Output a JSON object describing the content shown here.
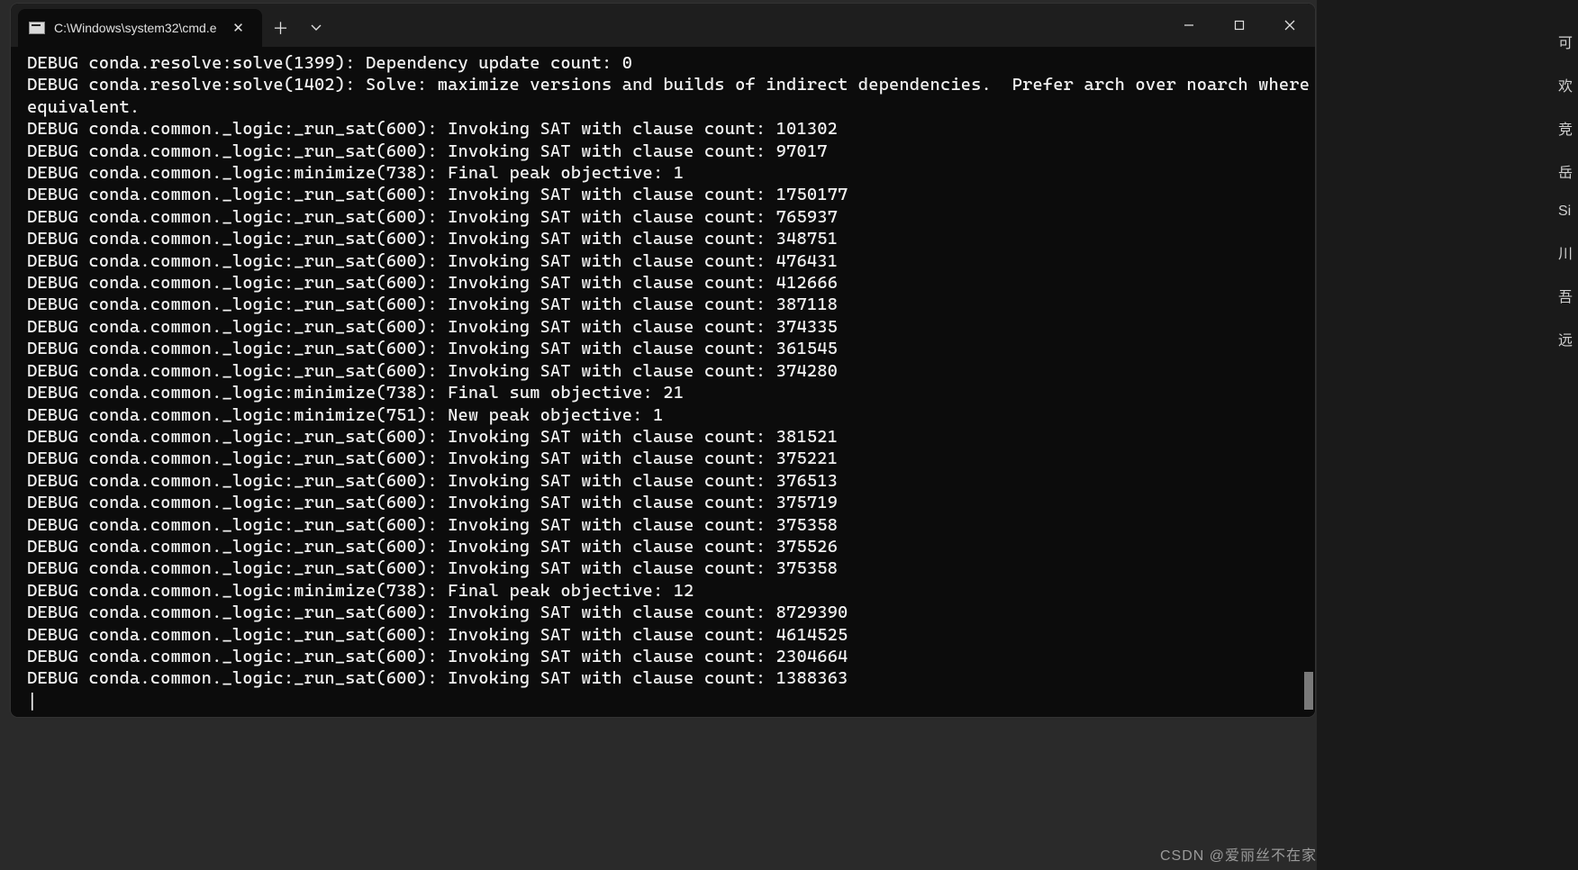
{
  "titlebar": {
    "tab_title": "C:\\Windows\\system32\\cmd.e",
    "close_glyph": "✕",
    "plus_glyph": "＋"
  },
  "terminal": {
    "lines": [
      "DEBUG conda.resolve:solve(1399): Dependency update count: 0",
      "DEBUG conda.resolve:solve(1402): Solve: maximize versions and builds of indirect dependencies.  Prefer arch over noarch where equivalent.",
      "DEBUG conda.common._logic:_run_sat(600): Invoking SAT with clause count: 101302",
      "DEBUG conda.common._logic:_run_sat(600): Invoking SAT with clause count: 97017",
      "DEBUG conda.common._logic:minimize(738): Final peak objective: 1",
      "DEBUG conda.common._logic:_run_sat(600): Invoking SAT with clause count: 1750177",
      "DEBUG conda.common._logic:_run_sat(600): Invoking SAT with clause count: 765937",
      "DEBUG conda.common._logic:_run_sat(600): Invoking SAT with clause count: 348751",
      "DEBUG conda.common._logic:_run_sat(600): Invoking SAT with clause count: 476431",
      "DEBUG conda.common._logic:_run_sat(600): Invoking SAT with clause count: 412666",
      "DEBUG conda.common._logic:_run_sat(600): Invoking SAT with clause count: 387118",
      "DEBUG conda.common._logic:_run_sat(600): Invoking SAT with clause count: 374335",
      "DEBUG conda.common._logic:_run_sat(600): Invoking SAT with clause count: 361545",
      "DEBUG conda.common._logic:_run_sat(600): Invoking SAT with clause count: 374280",
      "DEBUG conda.common._logic:minimize(738): Final sum objective: 21",
      "DEBUG conda.common._logic:minimize(751): New peak objective: 1",
      "DEBUG conda.common._logic:_run_sat(600): Invoking SAT with clause count: 381521",
      "DEBUG conda.common._logic:_run_sat(600): Invoking SAT with clause count: 375221",
      "DEBUG conda.common._logic:_run_sat(600): Invoking SAT with clause count: 376513",
      "DEBUG conda.common._logic:_run_sat(600): Invoking SAT with clause count: 375719",
      "DEBUG conda.common._logic:_run_sat(600): Invoking SAT with clause count: 375358",
      "DEBUG conda.common._logic:_run_sat(600): Invoking SAT with clause count: 375526",
      "DEBUG conda.common._logic:_run_sat(600): Invoking SAT with clause count: 375358",
      "DEBUG conda.common._logic:minimize(738): Final peak objective: 12",
      "DEBUG conda.common._logic:_run_sat(600): Invoking SAT with clause count: 8729390",
      "DEBUG conda.common._logic:_run_sat(600): Invoking SAT with clause count: 4614525",
      "DEBUG conda.common._logic:_run_sat(600): Invoking SAT with clause count: 2304664",
      "DEBUG conda.common._logic:_run_sat(600): Invoking SAT with clause count: 1388363"
    ],
    "cursor": "|"
  },
  "right_strip": {
    "items": [
      "可",
      "欢",
      "竞",
      "岳",
      "Si",
      "川",
      "吾",
      "远"
    ]
  },
  "watermark": "CSDN @爱丽丝不在家"
}
